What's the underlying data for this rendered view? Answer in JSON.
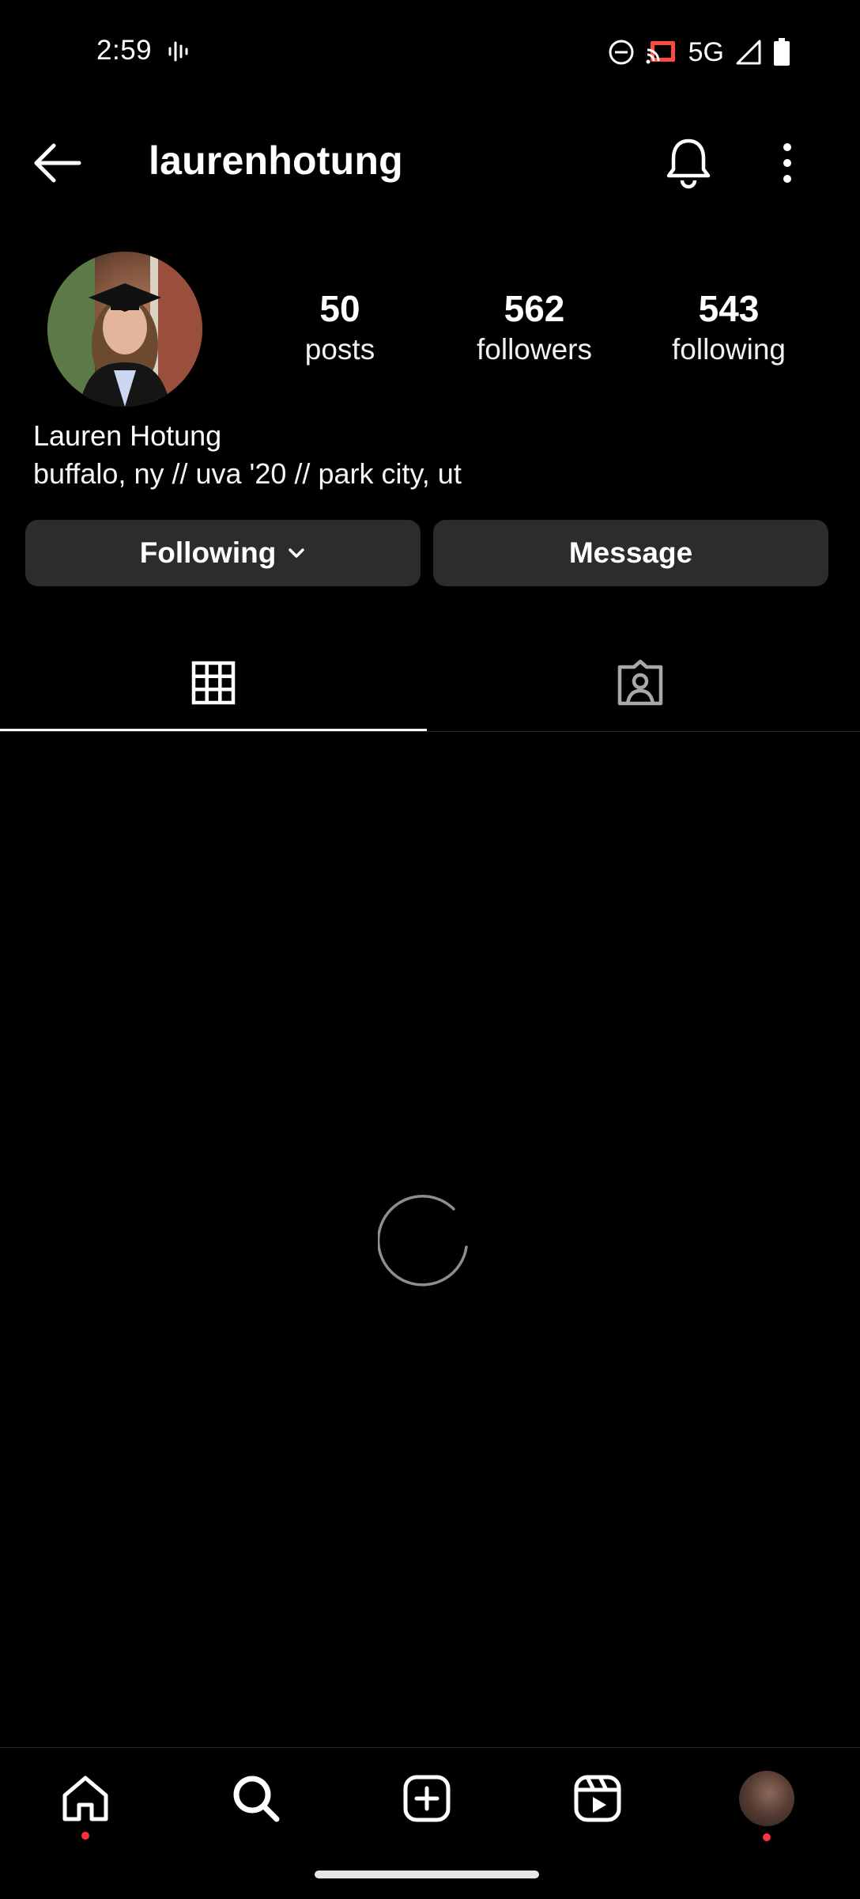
{
  "status_bar": {
    "time": "2:59",
    "network": "5G"
  },
  "header": {
    "username": "laurenhotung"
  },
  "profile": {
    "stats": [
      {
        "value": "50",
        "label": "posts"
      },
      {
        "value": "562",
        "label": "followers"
      },
      {
        "value": "543",
        "label": "following"
      }
    ],
    "display_name": "Lauren Hotung",
    "bio": "buffalo, ny // uva '20 // park city, ut"
  },
  "actions": {
    "following_label": "Following",
    "message_label": "Message"
  },
  "tabs": {
    "active": "grid-icon"
  },
  "colors": {
    "background": "#000000",
    "button_bg": "#2c2c2c",
    "notification_dot": "#ff3040"
  },
  "icons": [
    "back-arrow-icon",
    "bell-icon",
    "more-vertical-icon",
    "chevron-down-icon",
    "grid-icon",
    "tagged-icon",
    "home-icon",
    "search-icon",
    "create-icon",
    "reels-icon"
  ]
}
